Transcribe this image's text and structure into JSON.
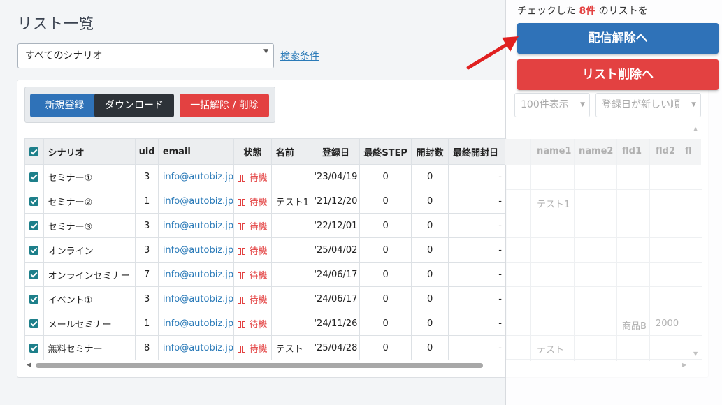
{
  "page_title": "リスト一覧",
  "scenario_select": {
    "value": "すべてのシナリオ"
  },
  "search_link": "検索条件",
  "buttons": {
    "new": "新規登録",
    "download": "ダウンロード",
    "bulk": "一括解除 / 削除"
  },
  "table": {
    "headers": [
      "シナリオ",
      "uid",
      "email",
      "状態",
      "名前",
      "登録日",
      "最終STEP",
      "開封数",
      "最終開封日"
    ],
    "rows": [
      {
        "scenario": "セミナー①",
        "uid": "3",
        "email": "info@autobiz.jp",
        "status": "待機",
        "name": "",
        "date": "'23/04/19",
        "step": "0",
        "opens": "0",
        "last": "-"
      },
      {
        "scenario": "セミナー②",
        "uid": "1",
        "email": "info@autobiz.jp",
        "status": "待機",
        "name": "テスト1",
        "date": "'21/12/20",
        "step": "0",
        "opens": "0",
        "last": "-"
      },
      {
        "scenario": "セミナー③",
        "uid": "3",
        "email": "info@autobiz.jp",
        "status": "待機",
        "name": "",
        "date": "'22/12/01",
        "step": "0",
        "opens": "0",
        "last": "-"
      },
      {
        "scenario": "オンライン",
        "uid": "3",
        "email": "info@autobiz.jp",
        "status": "待機",
        "name": "",
        "date": "'25/04/02",
        "step": "0",
        "opens": "0",
        "last": "-"
      },
      {
        "scenario": "オンラインセミナー",
        "uid": "7",
        "email": "info@autobiz.jp",
        "status": "待機",
        "name": "",
        "date": "'24/06/17",
        "step": "0",
        "opens": "0",
        "last": "-"
      },
      {
        "scenario": "イベント①",
        "uid": "3",
        "email": "info@autobiz.jp",
        "status": "待機",
        "name": "",
        "date": "'24/06/17",
        "step": "0",
        "opens": "0",
        "last": "-"
      },
      {
        "scenario": "メールセミナー",
        "uid": "1",
        "email": "info@autobiz.jp",
        "status": "待機",
        "name": "",
        "date": "'24/11/26",
        "step": "0",
        "opens": "0",
        "last": "-"
      },
      {
        "scenario": "無料セミナー",
        "uid": "8",
        "email": "info@autobiz.jp",
        "status": "待機",
        "name": "テスト",
        "date": "'25/04/28",
        "step": "0",
        "opens": "0",
        "last": "-"
      }
    ]
  },
  "overlay": {
    "check_prefix": "チェックした",
    "check_count": "8件",
    "check_suffix": "のリストを",
    "unsubscribe_btn": "配信解除へ",
    "delete_btn": "リスト削除へ",
    "per_page": "100件表示",
    "sort": "登録日が新しい順",
    "hidden_headers": [
      "name1",
      "name2",
      "fld1",
      "fld2",
      "fl"
    ],
    "hidden_cells": {
      "row2_name1": "テスト1",
      "row7_fld1": "商品B",
      "row7_fld2": "2000",
      "row8_name1": "テスト"
    }
  },
  "colors": {
    "primary": "#2f72b8",
    "danger": "#e34141",
    "dark": "#2d3238",
    "link": "#2a7ab8",
    "checkbox": "#1d7f8a"
  }
}
